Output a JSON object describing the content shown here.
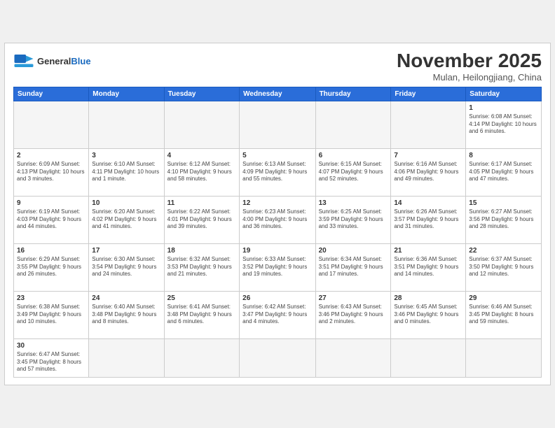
{
  "header": {
    "logo_line1": "General",
    "logo_line2": "Blue",
    "month": "November 2025",
    "location": "Mulan, Heilongjiang, China"
  },
  "weekdays": [
    "Sunday",
    "Monday",
    "Tuesday",
    "Wednesday",
    "Thursday",
    "Friday",
    "Saturday"
  ],
  "weeks": [
    [
      {
        "day": "",
        "info": ""
      },
      {
        "day": "",
        "info": ""
      },
      {
        "day": "",
        "info": ""
      },
      {
        "day": "",
        "info": ""
      },
      {
        "day": "",
        "info": ""
      },
      {
        "day": "",
        "info": ""
      },
      {
        "day": "1",
        "info": "Sunrise: 6:08 AM\nSunset: 4:14 PM\nDaylight: 10 hours\nand 6 minutes."
      }
    ],
    [
      {
        "day": "2",
        "info": "Sunrise: 6:09 AM\nSunset: 4:13 PM\nDaylight: 10 hours\nand 3 minutes."
      },
      {
        "day": "3",
        "info": "Sunrise: 6:10 AM\nSunset: 4:11 PM\nDaylight: 10 hours\nand 1 minute."
      },
      {
        "day": "4",
        "info": "Sunrise: 6:12 AM\nSunset: 4:10 PM\nDaylight: 9 hours\nand 58 minutes."
      },
      {
        "day": "5",
        "info": "Sunrise: 6:13 AM\nSunset: 4:09 PM\nDaylight: 9 hours\nand 55 minutes."
      },
      {
        "day": "6",
        "info": "Sunrise: 6:15 AM\nSunset: 4:07 PM\nDaylight: 9 hours\nand 52 minutes."
      },
      {
        "day": "7",
        "info": "Sunrise: 6:16 AM\nSunset: 4:06 PM\nDaylight: 9 hours\nand 49 minutes."
      },
      {
        "day": "8",
        "info": "Sunrise: 6:17 AM\nSunset: 4:05 PM\nDaylight: 9 hours\nand 47 minutes."
      }
    ],
    [
      {
        "day": "9",
        "info": "Sunrise: 6:19 AM\nSunset: 4:03 PM\nDaylight: 9 hours\nand 44 minutes."
      },
      {
        "day": "10",
        "info": "Sunrise: 6:20 AM\nSunset: 4:02 PM\nDaylight: 9 hours\nand 41 minutes."
      },
      {
        "day": "11",
        "info": "Sunrise: 6:22 AM\nSunset: 4:01 PM\nDaylight: 9 hours\nand 39 minutes."
      },
      {
        "day": "12",
        "info": "Sunrise: 6:23 AM\nSunset: 4:00 PM\nDaylight: 9 hours\nand 36 minutes."
      },
      {
        "day": "13",
        "info": "Sunrise: 6:25 AM\nSunset: 3:59 PM\nDaylight: 9 hours\nand 33 minutes."
      },
      {
        "day": "14",
        "info": "Sunrise: 6:26 AM\nSunset: 3:57 PM\nDaylight: 9 hours\nand 31 minutes."
      },
      {
        "day": "15",
        "info": "Sunrise: 6:27 AM\nSunset: 3:56 PM\nDaylight: 9 hours\nand 28 minutes."
      }
    ],
    [
      {
        "day": "16",
        "info": "Sunrise: 6:29 AM\nSunset: 3:55 PM\nDaylight: 9 hours\nand 26 minutes."
      },
      {
        "day": "17",
        "info": "Sunrise: 6:30 AM\nSunset: 3:54 PM\nDaylight: 9 hours\nand 24 minutes."
      },
      {
        "day": "18",
        "info": "Sunrise: 6:32 AM\nSunset: 3:53 PM\nDaylight: 9 hours\nand 21 minutes."
      },
      {
        "day": "19",
        "info": "Sunrise: 6:33 AM\nSunset: 3:52 PM\nDaylight: 9 hours\nand 19 minutes."
      },
      {
        "day": "20",
        "info": "Sunrise: 6:34 AM\nSunset: 3:51 PM\nDaylight: 9 hours\nand 17 minutes."
      },
      {
        "day": "21",
        "info": "Sunrise: 6:36 AM\nSunset: 3:51 PM\nDaylight: 9 hours\nand 14 minutes."
      },
      {
        "day": "22",
        "info": "Sunrise: 6:37 AM\nSunset: 3:50 PM\nDaylight: 9 hours\nand 12 minutes."
      }
    ],
    [
      {
        "day": "23",
        "info": "Sunrise: 6:38 AM\nSunset: 3:49 PM\nDaylight: 9 hours\nand 10 minutes."
      },
      {
        "day": "24",
        "info": "Sunrise: 6:40 AM\nSunset: 3:48 PM\nDaylight: 9 hours\nand 8 minutes."
      },
      {
        "day": "25",
        "info": "Sunrise: 6:41 AM\nSunset: 3:48 PM\nDaylight: 9 hours\nand 6 minutes."
      },
      {
        "day": "26",
        "info": "Sunrise: 6:42 AM\nSunset: 3:47 PM\nDaylight: 9 hours\nand 4 minutes."
      },
      {
        "day": "27",
        "info": "Sunrise: 6:43 AM\nSunset: 3:46 PM\nDaylight: 9 hours\nand 2 minutes."
      },
      {
        "day": "28",
        "info": "Sunrise: 6:45 AM\nSunset: 3:46 PM\nDaylight: 9 hours\nand 0 minutes."
      },
      {
        "day": "29",
        "info": "Sunrise: 6:46 AM\nSunset: 3:45 PM\nDaylight: 8 hours\nand 59 minutes."
      }
    ],
    [
      {
        "day": "30",
        "info": "Sunrise: 6:47 AM\nSunset: 3:45 PM\nDaylight: 8 hours\nand 57 minutes."
      },
      {
        "day": "",
        "info": ""
      },
      {
        "day": "",
        "info": ""
      },
      {
        "day": "",
        "info": ""
      },
      {
        "day": "",
        "info": ""
      },
      {
        "day": "",
        "info": ""
      },
      {
        "day": "",
        "info": ""
      }
    ]
  ]
}
